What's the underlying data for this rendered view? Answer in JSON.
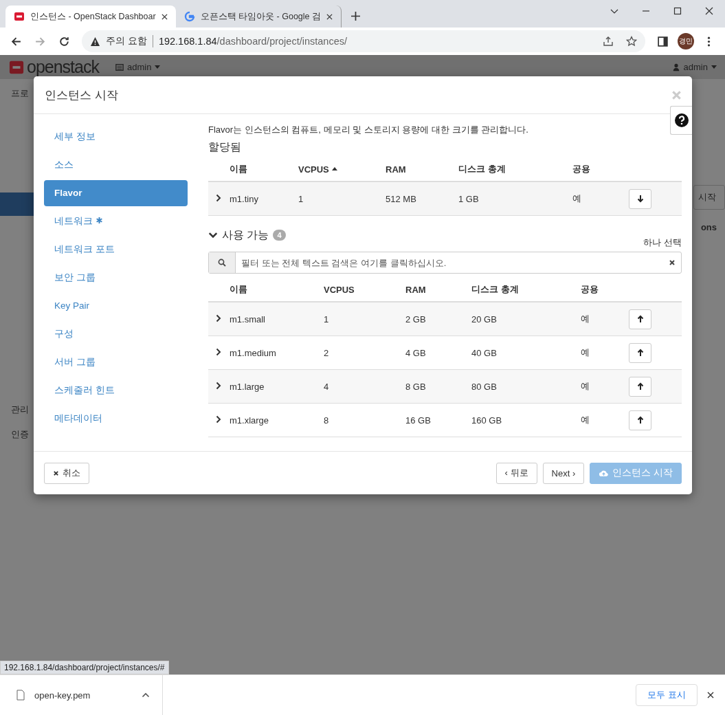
{
  "browser": {
    "tabs": [
      {
        "title": "인스턴스 - OpenStack Dashboar",
        "selected": true,
        "kind": "openstack"
      },
      {
        "title": "오픈스택 타임아웃 - Google 검",
        "selected": false,
        "kind": "google"
      }
    ],
    "address": {
      "warning": "주의 요함",
      "host": "192.168.1.84",
      "path": "/dashboard/project/instances/"
    },
    "profile": "경민"
  },
  "background": {
    "brand": "openstack",
    "project": "admin",
    "user": "admin",
    "fragments": [
      "프로",
      "관리",
      "인증"
    ],
    "button_fragment": "시작",
    "column_fragment": "ons"
  },
  "modal": {
    "title": "인스턴스 시작",
    "steps": [
      {
        "label": "세부 정보",
        "selected": false,
        "required": false
      },
      {
        "label": "소스",
        "selected": false,
        "required": false
      },
      {
        "label": "Flavor",
        "selected": true,
        "required": false
      },
      {
        "label": "네트워크",
        "selected": false,
        "required": true
      },
      {
        "label": "네트워크 포트",
        "selected": false,
        "required": false
      },
      {
        "label": "보안 그룹",
        "selected": false,
        "required": false
      },
      {
        "label": "Key Pair",
        "selected": false,
        "required": false
      },
      {
        "label": "구성",
        "selected": false,
        "required": false
      },
      {
        "label": "서버 그룹",
        "selected": false,
        "required": false
      },
      {
        "label": "스케줄러 힌트",
        "selected": false,
        "required": false
      },
      {
        "label": "메타데이터",
        "selected": false,
        "required": false
      }
    ],
    "description": "Flavor는 인스턴스의 컴퓨트, 메모리 및 스토리지 용량에 대한 크기를 관리합니다.",
    "allocated": {
      "title": "할당됨",
      "columns": [
        {
          "label": "이름",
          "sorted": false
        },
        {
          "label": "VCPUS",
          "sorted": true
        },
        {
          "label": "RAM",
          "sorted": false
        },
        {
          "label": "디스크 총계",
          "sorted": false
        },
        {
          "label": "공용",
          "sorted": false
        }
      ],
      "rows": [
        {
          "name": "m1.tiny",
          "vcpus": "1",
          "ram": "512 MB",
          "disk": "1 GB",
          "public": "예"
        }
      ]
    },
    "available": {
      "title": "사용 가능",
      "count": "4",
      "expanded": true,
      "select_label": "하나 선택",
      "placeholder": "필터 또는 전체 텍스트 검색은 여기를 클릭하십시오.",
      "columns": [
        {
          "label": "이름",
          "sorted": false
        },
        {
          "label": "VCPUS",
          "sorted": false
        },
        {
          "label": "RAM",
          "sorted": false
        },
        {
          "label": "디스크 총계",
          "sorted": false
        },
        {
          "label": "공용",
          "sorted": false
        }
      ],
      "rows": [
        {
          "name": "m1.small",
          "vcpus": "1",
          "ram": "2 GB",
          "disk": "20 GB",
          "public": "예"
        },
        {
          "name": "m1.medium",
          "vcpus": "2",
          "ram": "4 GB",
          "disk": "40 GB",
          "public": "예"
        },
        {
          "name": "m1.large",
          "vcpus": "4",
          "ram": "8 GB",
          "disk": "80 GB",
          "public": "예"
        },
        {
          "name": "m1.xlarge",
          "vcpus": "8",
          "ram": "16 GB",
          "disk": "160 GB",
          "public": "예"
        }
      ]
    },
    "footer": {
      "cancel": "취소",
      "back": "‹ 뒤로",
      "next": "Next ›",
      "launch": "인스턴스 시작",
      "launch_disabled": true
    }
  },
  "status_url": "192.168.1.84/dashboard/project/instances/#",
  "download": {
    "file": "open-key.pem",
    "show_all": "모두 표시"
  }
}
